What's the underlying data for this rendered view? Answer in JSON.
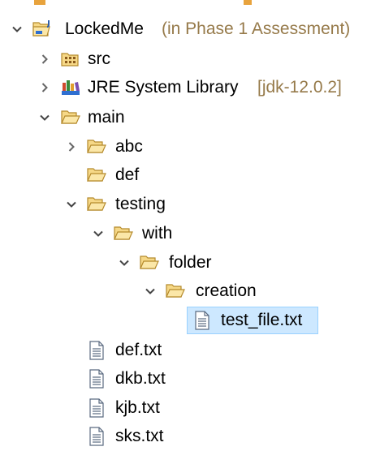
{
  "tree": {
    "project": {
      "label": "LockedMe",
      "decoration": "(in Phase 1 Assessment)"
    },
    "src": {
      "label": "src"
    },
    "jre": {
      "label": "JRE System Library",
      "decoration": "[jdk-12.0.2]"
    },
    "main": {
      "label": "main"
    },
    "abc": {
      "label": "abc"
    },
    "def": {
      "label": "def"
    },
    "testing": {
      "label": "testing"
    },
    "with": {
      "label": "with"
    },
    "folder": {
      "label": "folder"
    },
    "creation": {
      "label": "creation"
    },
    "test_file": {
      "label": "test_file.txt"
    },
    "def_txt": {
      "label": "def.txt"
    },
    "dkb_txt": {
      "label": "dkb.txt"
    },
    "kjb_txt": {
      "label": "kjb.txt"
    },
    "sks_txt": {
      "label": "sks.txt"
    }
  },
  "colors": {
    "selection_bg": "#cde8ff",
    "selection_border": "#99d1ff",
    "decoration_text": "#967a4a",
    "folder_fill": "#f6d887",
    "folder_stroke": "#b58a2c"
  },
  "icons": {
    "expanded": "chevron-down-icon",
    "collapsed": "chevron-right-icon",
    "project": "java-project-icon",
    "package": "source-folder-icon",
    "library": "library-icon",
    "folder": "folder-open-icon",
    "file": "text-file-icon"
  }
}
